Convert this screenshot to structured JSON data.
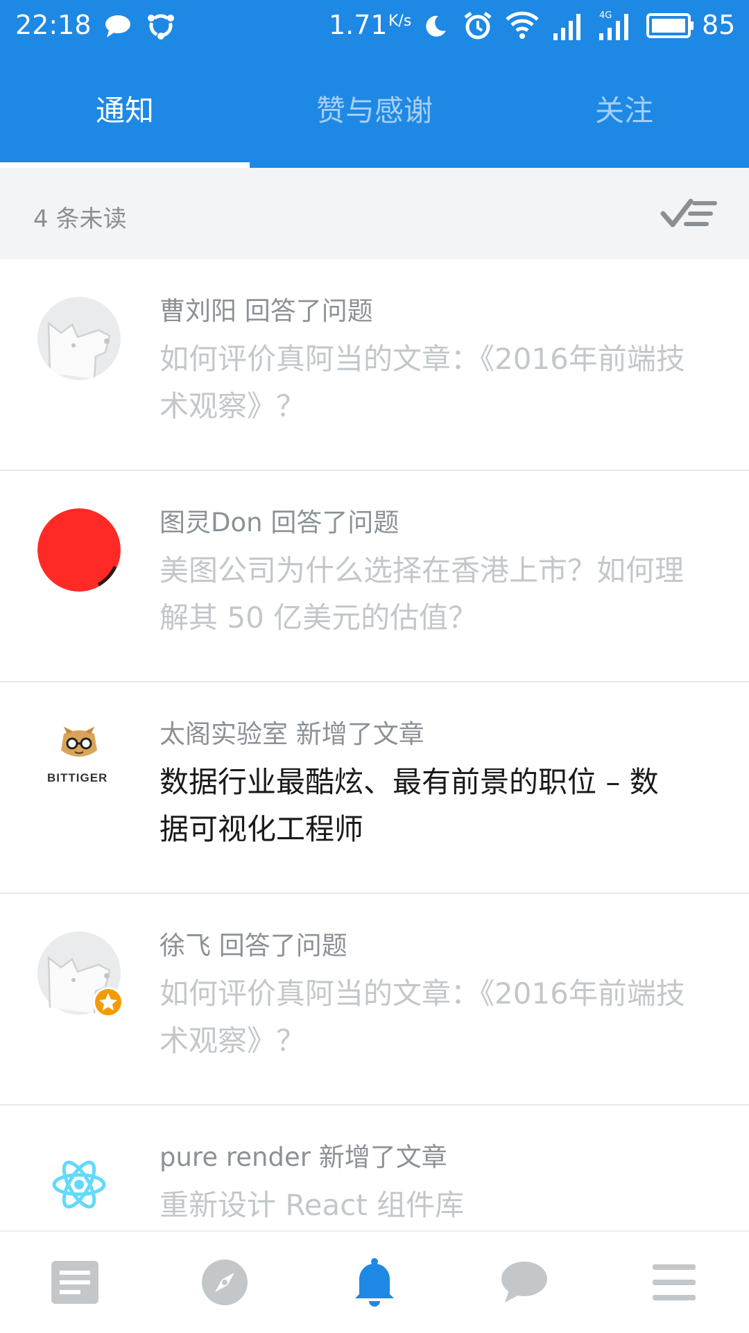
{
  "status_bar": {
    "time": "22:18",
    "speed": "1.71",
    "speed_unit": "K/s",
    "battery": "85",
    "icons": [
      "message-bubble-icon",
      "sync-icon",
      "moon-icon",
      "alarm-icon",
      "wifi-icon",
      "signal-icon",
      "signal-4g-icon",
      "battery-icon"
    ]
  },
  "tabs": [
    {
      "label": "通知",
      "active": true
    },
    {
      "label": "赞与感谢",
      "active": false
    },
    {
      "label": "关注",
      "active": false
    }
  ],
  "unread_bar": {
    "text": "4 条未读",
    "action_icon": "mark-all-read-icon"
  },
  "notifications": [
    {
      "actor": "曹刘阳",
      "action": "回答了问题",
      "meta": "曹刘阳 回答了问题",
      "title": "如何评价真阿当的文章：《2016年前端技术观察》？",
      "avatar": "default-avatar-icon",
      "read": true
    },
    {
      "actor": "图灵Don",
      "action": "回答了问题",
      "meta": "图灵Don 回答了问题",
      "title": "美图公司为什么选择在香港上市？如何理解其 50 亿美元的估值？",
      "avatar": "red-circle-avatar",
      "read": true
    },
    {
      "actor": "太阁实验室",
      "action": "新增了文章",
      "meta": "太阁实验室 新增了文章",
      "title": "数据行业最酷炫、最有前景的职位 – 数据可视化工程师",
      "avatar": "bittiger-logo",
      "avatar_text": "BITTIGER",
      "read": false
    },
    {
      "actor": "徐飞",
      "action": "回答了问题",
      "meta": "徐飞 回答了问题",
      "title": "如何评价真阿当的文章：《2016年前端技术观察》？",
      "avatar": "default-avatar-icon",
      "badge": "star-badge-icon",
      "read": true
    },
    {
      "actor": "pure render",
      "action": "新增了文章",
      "meta": "pure render 新增了文章",
      "title": "重新设计 React 组件库",
      "avatar": "react-logo",
      "read": true
    }
  ],
  "bottom_nav": [
    {
      "icon": "feed-icon",
      "active": false
    },
    {
      "icon": "explore-compass-icon",
      "active": false
    },
    {
      "icon": "bell-icon",
      "active": true
    },
    {
      "icon": "chat-bubble-icon",
      "active": false
    },
    {
      "icon": "menu-icon",
      "active": false
    }
  ],
  "colors": {
    "primary": "#1e88e5",
    "unread_bg": "#f2f4f5",
    "meta_text": "#8b9196",
    "read_title": "#c3c7ca",
    "unread_title": "#1a1a1a",
    "nav_inactive": "#c4c7ca",
    "badge": "#f59b00",
    "react": "#61dafb"
  }
}
